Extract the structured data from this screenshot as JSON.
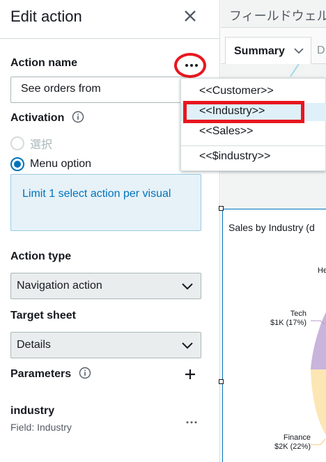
{
  "panel": {
    "title": "Edit action",
    "action_name": {
      "label": "Action name",
      "value": "See orders from"
    },
    "activation": {
      "label": "Activation",
      "options": [
        {
          "label": "選択",
          "selected": false,
          "disabled": true
        },
        {
          "label": "Menu option",
          "selected": true,
          "disabled": false
        }
      ],
      "info": "Limit 1 select action per visual"
    },
    "action_type": {
      "label": "Action type",
      "value": "Navigation action"
    },
    "target_sheet": {
      "label": "Target sheet",
      "value": "Details"
    },
    "parameters": {
      "label": "Parameters",
      "items": [
        {
          "name": "industry",
          "field": "Field: Industry"
        }
      ]
    }
  },
  "menu": {
    "items": [
      "<<Customer>>",
      "<<Industry>>",
      "<<Sales>>",
      "<<$industry>>"
    ],
    "hovered_index": 1
  },
  "right": {
    "top_field": "フィールドウェル",
    "tabs": {
      "active": "Summary",
      "next": "D"
    },
    "visual": {
      "title": "Sales by Industry (d",
      "labels": [
        {
          "name": "He",
          "value": ""
        },
        {
          "name": "Tech",
          "value": "$1K (17%)"
        },
        {
          "name": "Finance",
          "value": "$2K (22%)"
        }
      ]
    }
  },
  "colors": {
    "accent": "#0073bb",
    "annotation_red": "#e8171f",
    "pie_purple": "#c9b4dc",
    "pie_yellow": "#fce6b4"
  }
}
